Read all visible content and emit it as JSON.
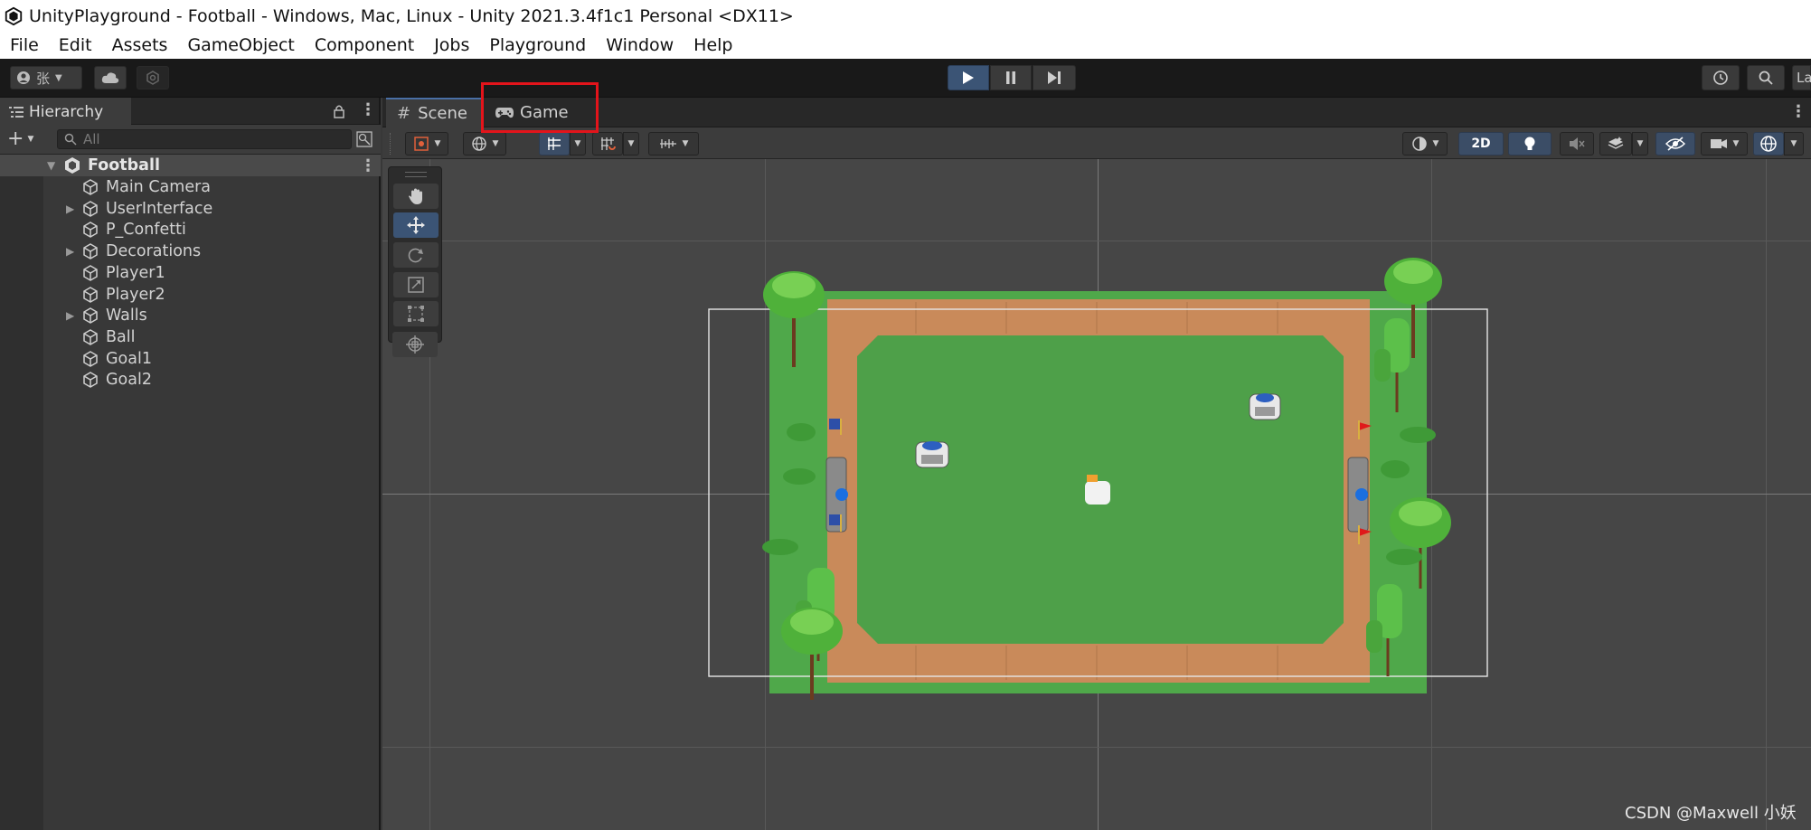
{
  "window": {
    "title": "UnityPlayground - Football - Windows, Mac, Linux - Unity 2021.3.4f1c1 Personal <DX11>"
  },
  "menu": [
    "File",
    "Edit",
    "Assets",
    "GameObject",
    "Component",
    "Jobs",
    "Playground",
    "Window",
    "Help"
  ],
  "toolbar": {
    "account_label": "张",
    "right_partial_label": "La"
  },
  "hierarchy": {
    "tab_label": "Hierarchy",
    "search_placeholder": "All",
    "scene_name": "Football",
    "items": [
      {
        "label": "Main Camera",
        "expandable": false
      },
      {
        "label": "UserInterface",
        "expandable": true
      },
      {
        "label": "P_Confetti",
        "expandable": false
      },
      {
        "label": "Decorations",
        "expandable": true
      },
      {
        "label": "Player1",
        "expandable": false
      },
      {
        "label": "Player2",
        "expandable": false
      },
      {
        "label": "Walls",
        "expandable": true
      },
      {
        "label": "Ball",
        "expandable": false
      },
      {
        "label": "Goal1",
        "expandable": false
      },
      {
        "label": "Goal2",
        "expandable": false
      }
    ]
  },
  "scene_view": {
    "tabs": [
      {
        "label": "Scene",
        "icon": "grid-icon",
        "active": true
      },
      {
        "label": "Game",
        "icon": "gamepad-icon",
        "active": false
      }
    ],
    "mode_2d_label": "2D",
    "tool_palette": [
      "hand-icon",
      "move-icon",
      "rotate-icon",
      "scale-icon",
      "rect-icon",
      "transform-icon"
    ],
    "active_tool": "move-icon"
  },
  "annotation": {
    "color": "#e3141b",
    "target": "Game tab"
  },
  "watermark": "CSDN @Maxwell 小妖",
  "colors": {
    "play_active": "#3b5475",
    "grass": "#4fa84a",
    "dirt": "#c98a5a"
  }
}
